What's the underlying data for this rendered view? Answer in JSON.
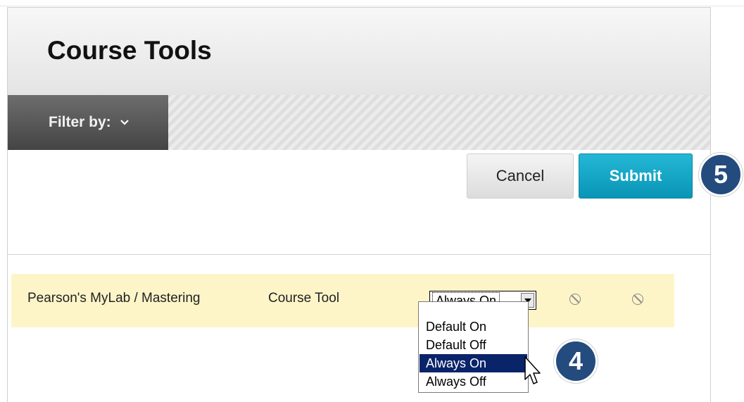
{
  "header": {
    "title": "Course Tools"
  },
  "filter": {
    "label": "Filter by:"
  },
  "actions": {
    "cancel_label": "Cancel",
    "submit_label": "Submit"
  },
  "steps": {
    "submit_step": "5",
    "dropdown_step": "4"
  },
  "tool_row": {
    "name": "Pearson's MyLab / Mastering",
    "type": "Course Tool",
    "availability": "Always On"
  },
  "availability_options": [
    "Default On",
    "Default Off",
    "Always On",
    "Always Off"
  ],
  "colors": {
    "submit": "#0995b6",
    "badge": "#234b7d",
    "row_highlight": "#fdf5c8",
    "option_selected": "#0a246a"
  },
  "icons": {
    "filter_chevron": "chevron-down-icon",
    "status": "not-available-icon"
  }
}
